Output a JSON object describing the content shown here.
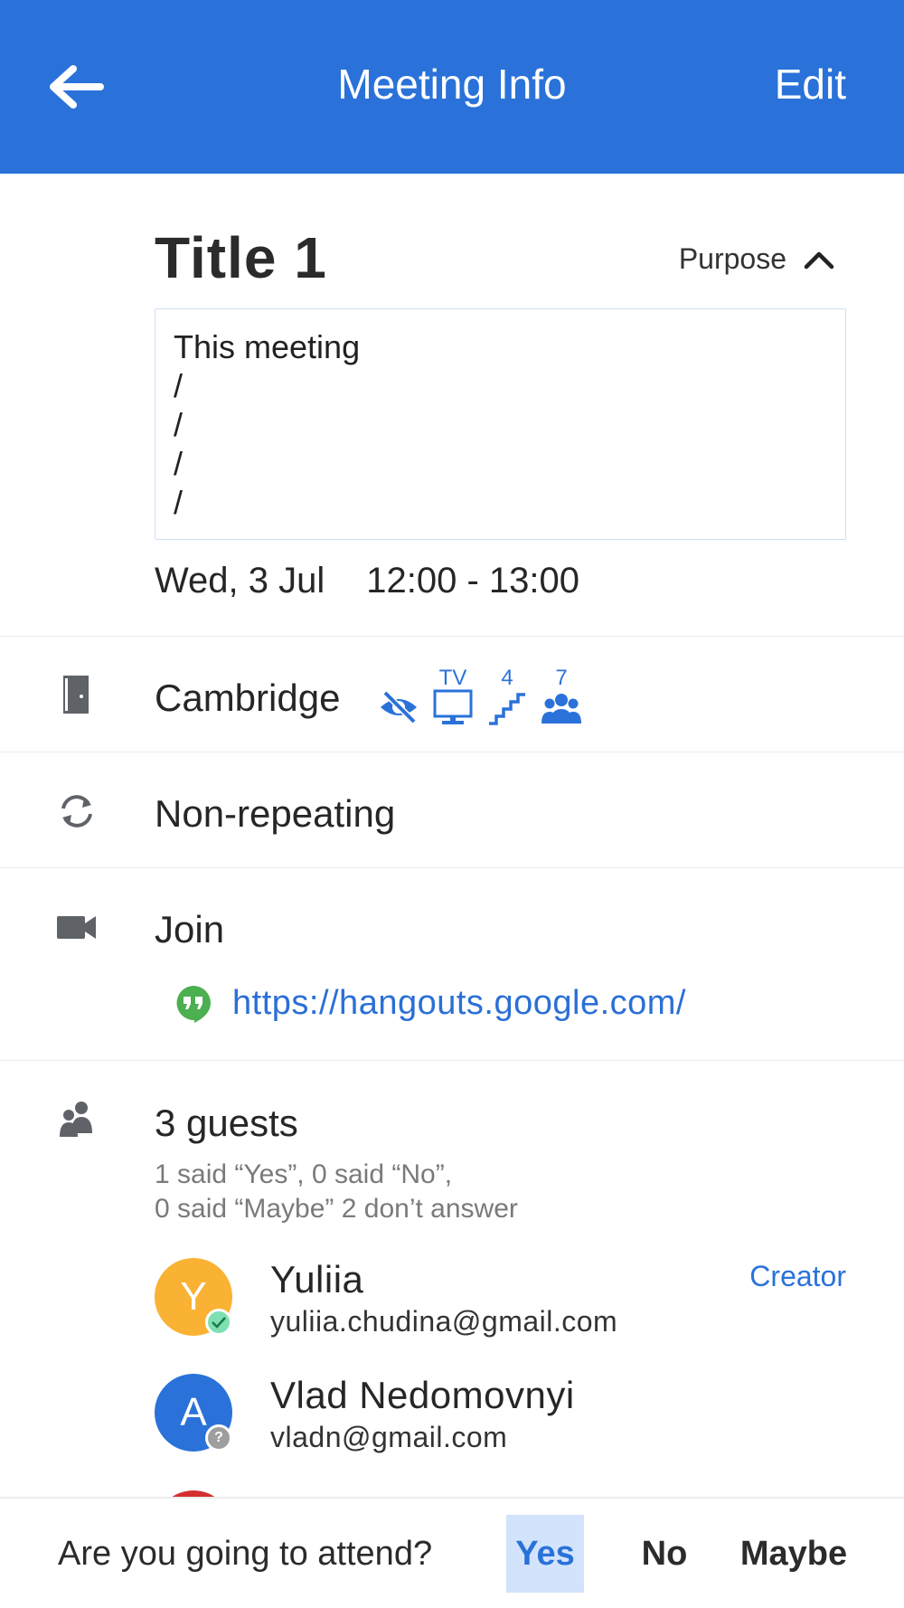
{
  "appbar": {
    "title": "Meeting Info",
    "edit_label": "Edit"
  },
  "meeting": {
    "title": "Title 1",
    "purpose_label": "Purpose",
    "purpose_text": "This meeting\n/\n/\n/\n/",
    "date": "Wed, 3 Jul",
    "time": "12:00 - 13:00"
  },
  "room": {
    "name": "Cambridge",
    "amenities": {
      "tv_label": "TV",
      "floor": "4",
      "capacity": "7"
    }
  },
  "recurrence": {
    "label": "Non-repeating"
  },
  "conference": {
    "label": "Join",
    "link": "https://hangouts.google.com/"
  },
  "guests": {
    "count_label": "3 guests",
    "summary_line1": "1 said “Yes”, 0 said “No”,",
    "summary_line2": "0 said “Maybe” 2 don’t answer",
    "list": [
      {
        "initial": "Y",
        "name": "Yuliia",
        "email": "yuliia.chudina@gmail.com",
        "role": "Creator",
        "color": "#f9b233",
        "status": "yes"
      },
      {
        "initial": "A",
        "name": "Vlad Nedomovnyi",
        "email": "vladn@gmail.com",
        "role": "",
        "color": "#2a72d9",
        "status": "unknown"
      }
    ]
  },
  "rsvp": {
    "question": "Are you going to attend?",
    "yes": "Yes",
    "no": "No",
    "maybe": "Maybe",
    "selected": "Yes"
  },
  "colors": {
    "primary": "#2a72d9",
    "accent_green": "#4caf50",
    "avatar_red": "#d32f2f"
  }
}
